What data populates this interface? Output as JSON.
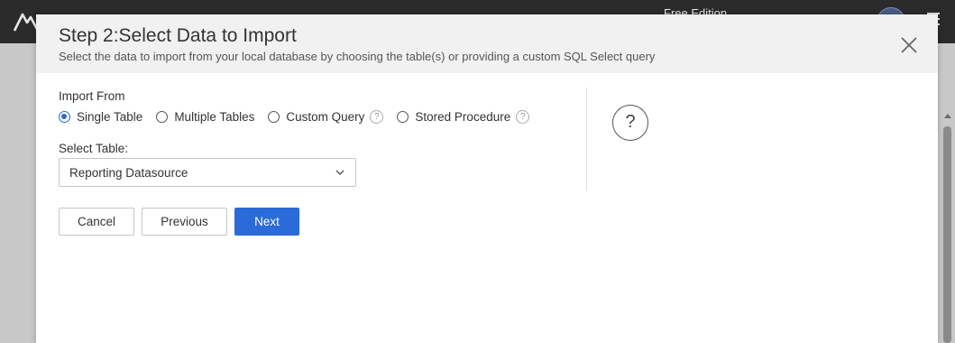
{
  "app": {
    "edition": "Free Edition"
  },
  "modal": {
    "title": "Step 2:Select Data to Import",
    "subtitle": "Select the data to import from your local database by choosing the table(s) or providing a custom SQL Select query"
  },
  "import_from": {
    "label": "Import From",
    "options": [
      {
        "label": "Single Table",
        "checked": true,
        "help": false
      },
      {
        "label": "Multiple Tables",
        "checked": false,
        "help": false
      },
      {
        "label": "Custom Query",
        "checked": false,
        "help": true
      },
      {
        "label": "Stored Procedure",
        "checked": false,
        "help": true
      }
    ],
    "help_glyph": "?"
  },
  "select_table": {
    "label": "Select Table:",
    "value": "Reporting Datasource"
  },
  "help_panel": {
    "glyph": "?"
  },
  "buttons": {
    "cancel": "Cancel",
    "previous": "Previous",
    "next": "Next"
  },
  "colors": {
    "accent": "#2a6bd8",
    "topbar": "#2b2b2b",
    "header_bg": "#f1f1f1"
  },
  "icons": [
    "app-logo-icon",
    "avatar",
    "hamburger-menu-icon",
    "close-icon",
    "help-icon",
    "chevron-down-icon"
  ]
}
